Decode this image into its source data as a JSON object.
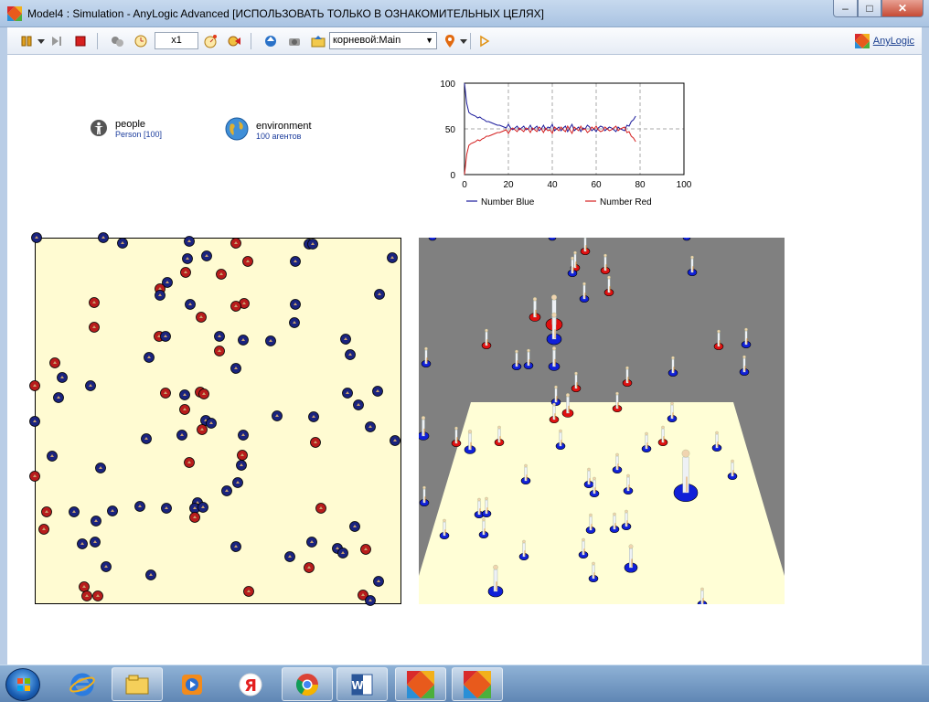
{
  "window": {
    "title": "Model4 : Simulation - AnyLogic Advanced [ИСПОЛЬЗОВАТЬ ТОЛЬКО В ОЗНАКОМИТЕЛЬНЫХ ЦЕЛЯХ]",
    "min_label": "–",
    "max_label": "□",
    "close_label": "✕"
  },
  "toolbar": {
    "speed_value": "x1",
    "agent_combo_value": "корневой:Main",
    "brand_label": "AnyLogic"
  },
  "objects": {
    "people": {
      "name": "people",
      "sub": "Person [100]"
    },
    "environment": {
      "name": "environment",
      "sub": "100 агентов"
    }
  },
  "chart_data": {
    "type": "line",
    "xlim": [
      0,
      100
    ],
    "ylim": [
      0,
      100
    ],
    "xticks": [
      "0",
      "20",
      "40",
      "60",
      "80",
      "100"
    ],
    "yticks": [
      "0",
      "50",
      "100"
    ],
    "grid": true,
    "legend_placement": "bottom",
    "series": [
      {
        "name": "Number Blue",
        "color": "#1c1c9c",
        "x": [
          0,
          1,
          2,
          3,
          4,
          5,
          6,
          7,
          8,
          9,
          10,
          11,
          12,
          13,
          14,
          15,
          16,
          17,
          18,
          19,
          20,
          21,
          22,
          23,
          24,
          25,
          26,
          27,
          28,
          29,
          30,
          31,
          32,
          33,
          34,
          35,
          36,
          37,
          38,
          39,
          40,
          41,
          42,
          43,
          44,
          45,
          46,
          47,
          48,
          49,
          50,
          51,
          52,
          53,
          54,
          55,
          56,
          57,
          58,
          59,
          60,
          61,
          62,
          63,
          64,
          65,
          66,
          67,
          68,
          69,
          70,
          71,
          72,
          73,
          74,
          75,
          76,
          77,
          78
        ],
        "values": [
          100,
          78,
          68,
          66,
          65,
          64,
          62,
          63,
          61,
          60,
          58,
          58,
          57,
          56,
          55,
          54,
          54,
          53,
          52,
          51,
          55,
          51,
          49,
          51,
          53,
          49,
          51,
          53,
          49,
          50,
          54,
          49,
          51,
          53,
          48,
          50,
          54,
          49,
          52,
          51,
          55,
          48,
          50,
          52,
          48,
          51,
          53,
          47,
          51,
          55,
          48,
          50,
          52,
          47,
          51,
          50,
          54,
          52,
          48,
          50,
          47,
          51,
          53,
          52,
          48,
          50,
          52,
          51,
          49,
          47,
          52,
          50,
          49,
          48,
          54,
          53,
          58,
          60,
          64
        ]
      },
      {
        "name": "Number Red",
        "color": "#d42020",
        "x": [
          0,
          1,
          2,
          3,
          4,
          5,
          6,
          7,
          8,
          9,
          10,
          11,
          12,
          13,
          14,
          15,
          16,
          17,
          18,
          19,
          20,
          21,
          22,
          23,
          24,
          25,
          26,
          27,
          28,
          29,
          30,
          31,
          32,
          33,
          34,
          35,
          36,
          37,
          38,
          39,
          40,
          41,
          42,
          43,
          44,
          45,
          46,
          47,
          48,
          49,
          50,
          51,
          52,
          53,
          54,
          55,
          56,
          57,
          58,
          59,
          60,
          61,
          62,
          63,
          64,
          65,
          66,
          67,
          68,
          69,
          70,
          71,
          72,
          73,
          74,
          75,
          76,
          77,
          78
        ],
        "values": [
          0,
          22,
          32,
          34,
          35,
          36,
          38,
          37,
          39,
          40,
          42,
          42,
          43,
          44,
          45,
          46,
          46,
          47,
          48,
          49,
          45,
          49,
          51,
          49,
          47,
          51,
          49,
          47,
          51,
          50,
          46,
          51,
          49,
          47,
          52,
          50,
          46,
          51,
          48,
          49,
          45,
          52,
          50,
          48,
          52,
          49,
          47,
          53,
          49,
          45,
          52,
          50,
          48,
          53,
          49,
          50,
          46,
          48,
          52,
          50,
          53,
          49,
          47,
          48,
          52,
          50,
          48,
          49,
          51,
          53,
          48,
          50,
          51,
          52,
          46,
          47,
          42,
          40,
          36
        ]
      }
    ]
  },
  "sim2d": {
    "blue_color": "#1a237e",
    "red_color": "#b81c1c",
    "agents": [
      [
        2,
        0,
        "b"
      ],
      [
        75,
        0,
        "b"
      ],
      [
        96,
        6,
        "b"
      ],
      [
        188,
        20,
        "b"
      ],
      [
        220,
        6,
        "r"
      ],
      [
        169,
        4,
        "b"
      ],
      [
        300,
        7,
        "b"
      ],
      [
        304,
        7,
        "b"
      ],
      [
        391,
        22,
        "b"
      ],
      [
        233,
        26,
        "r"
      ],
      [
        285,
        26,
        "b"
      ],
      [
        167,
        23,
        "b"
      ],
      [
        165,
        38,
        "r"
      ],
      [
        204,
        40,
        "r"
      ],
      [
        145,
        49,
        "b"
      ],
      [
        137,
        56,
        "r"
      ],
      [
        137,
        63,
        "b"
      ],
      [
        377,
        62,
        "b"
      ],
      [
        65,
        71,
        "r"
      ],
      [
        229,
        72,
        "r"
      ],
      [
        220,
        75,
        "r"
      ],
      [
        170,
        73,
        "b"
      ],
      [
        285,
        73,
        "b"
      ],
      [
        182,
        87,
        "r"
      ],
      [
        284,
        93,
        "b"
      ],
      [
        65,
        98,
        "r"
      ],
      [
        136,
        108,
        "r"
      ],
      [
        143,
        108,
        "b"
      ],
      [
        202,
        108,
        "b"
      ],
      [
        228,
        112,
        "b"
      ],
      [
        258,
        113,
        "b"
      ],
      [
        340,
        111,
        "b"
      ],
      [
        202,
        124,
        "r"
      ],
      [
        125,
        131,
        "b"
      ],
      [
        345,
        128,
        "b"
      ],
      [
        22,
        137,
        "r"
      ],
      [
        220,
        143,
        "b"
      ],
      [
        30,
        153,
        "b"
      ],
      [
        0,
        162,
        "r"
      ],
      [
        61,
        162,
        "b"
      ],
      [
        143,
        170,
        "r"
      ],
      [
        164,
        172,
        "b"
      ],
      [
        181,
        169,
        "r"
      ],
      [
        375,
        168,
        "b"
      ],
      [
        26,
        175,
        "b"
      ],
      [
        342,
        170,
        "b"
      ],
      [
        164,
        188,
        "r"
      ],
      [
        354,
        183,
        "b"
      ],
      [
        185,
        171,
        "r"
      ],
      [
        187,
        200,
        "b"
      ],
      [
        193,
        203,
        "b"
      ],
      [
        265,
        195,
        "b"
      ],
      [
        305,
        196,
        "b"
      ],
      [
        0,
        201,
        "b"
      ],
      [
        183,
        210,
        "r"
      ],
      [
        161,
        216,
        "b"
      ],
      [
        122,
        220,
        "b"
      ],
      [
        228,
        216,
        "b"
      ],
      [
        367,
        207,
        "b"
      ],
      [
        307,
        224,
        "r"
      ],
      [
        394,
        222,
        "b"
      ],
      [
        19,
        239,
        "b"
      ],
      [
        227,
        238,
        "r"
      ],
      [
        169,
        246,
        "r"
      ],
      [
        72,
        252,
        "b"
      ],
      [
        226,
        249,
        "b"
      ],
      [
        0,
        261,
        "r"
      ],
      [
        222,
        268,
        "b"
      ],
      [
        210,
        277,
        "b"
      ],
      [
        178,
        290,
        "b"
      ],
      [
        175,
        296,
        "b"
      ],
      [
        184,
        295,
        "b"
      ],
      [
        43,
        300,
        "b"
      ],
      [
        13,
        300,
        "r"
      ],
      [
        115,
        294,
        "b"
      ],
      [
        313,
        296,
        "r"
      ],
      [
        67,
        310,
        "b"
      ],
      [
        85,
        299,
        "b"
      ],
      [
        144,
        296,
        "b"
      ],
      [
        350,
        316,
        "b"
      ],
      [
        66,
        333,
        "b"
      ],
      [
        52,
        335,
        "b"
      ],
      [
        220,
        338,
        "b"
      ],
      [
        303,
        333,
        "b"
      ],
      [
        331,
        340,
        "b"
      ],
      [
        337,
        345,
        "b"
      ],
      [
        362,
        341,
        "r"
      ],
      [
        279,
        349,
        "b"
      ],
      [
        78,
        360,
        "b"
      ],
      [
        300,
        361,
        "r"
      ],
      [
        127,
        369,
        "b"
      ],
      [
        376,
        376,
        "b"
      ],
      [
        54,
        382,
        "r"
      ],
      [
        234,
        387,
        "r"
      ],
      [
        359,
        391,
        "r"
      ],
      [
        57,
        392,
        "r"
      ],
      [
        69,
        392,
        "r"
      ],
      [
        367,
        397,
        "b"
      ],
      [
        10,
        319,
        "r"
      ],
      [
        175,
        306,
        "r"
      ]
    ]
  },
  "sim3d": {
    "background": "#808080",
    "floor": "#fffed6",
    "agents": [
      [
        182,
        15,
        "r",
        5
      ],
      [
        171,
        33,
        "r",
        5
      ],
      [
        204,
        36,
        "r",
        5
      ],
      [
        168,
        39,
        "b",
        5
      ],
      [
        208,
        60,
        "r",
        5
      ],
      [
        181,
        67,
        "b",
        5
      ],
      [
        127,
        87,
        "r",
        6
      ],
      [
        148,
        95,
        "r",
        9
      ],
      [
        148,
        111,
        "b",
        8
      ],
      [
        299,
        38,
        "b",
        5
      ],
      [
        328,
        119,
        "r",
        5
      ],
      [
        358,
        117,
        "b",
        5
      ],
      [
        8,
        138,
        "b",
        5
      ],
      [
        107,
        141,
        "b",
        5
      ],
      [
        120,
        140,
        "b",
        5
      ],
      [
        148,
        141,
        "b",
        6
      ],
      [
        74,
        118,
        "r",
        5
      ],
      [
        278,
        148,
        "b",
        5
      ],
      [
        356,
        147,
        "b",
        5
      ],
      [
        228,
        159,
        "r",
        5
      ],
      [
        172,
        165,
        "r",
        5
      ],
      [
        150,
        180,
        "b",
        5
      ],
      [
        217,
        187,
        "r",
        5
      ],
      [
        163,
        192,
        "r",
        6
      ],
      [
        277,
        198,
        "b",
        5
      ],
      [
        148,
        199,
        "r",
        5
      ],
      [
        5,
        217,
        "b",
        6
      ],
      [
        41,
        225,
        "r",
        5
      ],
      [
        56,
        232,
        "b",
        6
      ],
      [
        88,
        224,
        "r",
        5
      ],
      [
        155,
        228,
        "b",
        5
      ],
      [
        249,
        231,
        "b",
        5
      ],
      [
        267,
        224,
        "r",
        5
      ],
      [
        326,
        230,
        "b",
        5
      ],
      [
        217,
        254,
        "b",
        5
      ],
      [
        117,
        266,
        "b",
        5
      ],
      [
        186,
        270,
        "b",
        5
      ],
      [
        192,
        280,
        "b",
        5
      ],
      [
        229,
        277,
        "b",
        5
      ],
      [
        343,
        261,
        "b",
        5
      ],
      [
        292,
        279,
        "b",
        13
      ],
      [
        6,
        290,
        "b",
        5
      ],
      [
        66,
        303,
        "b",
        5
      ],
      [
        74,
        302,
        "b",
        5
      ],
      [
        188,
        320,
        "b",
        5
      ],
      [
        214,
        319,
        "b",
        5
      ],
      [
        227,
        316,
        "b",
        5
      ],
      [
        28,
        326,
        "b",
        5
      ],
      [
        71,
        325,
        "b",
        5
      ],
      [
        180,
        347,
        "b",
        5
      ],
      [
        115,
        349,
        "b",
        5
      ],
      [
        232,
        361,
        "b",
        7
      ],
      [
        191,
        373,
        "b",
        5
      ],
      [
        84,
        387,
        "b",
        8
      ],
      [
        310,
        401,
        "b",
        5
      ],
      [
        146,
        0,
        "b",
        4
      ],
      [
        293,
        0,
        "b",
        4
      ],
      [
        15,
        0,
        "b",
        4
      ]
    ]
  }
}
